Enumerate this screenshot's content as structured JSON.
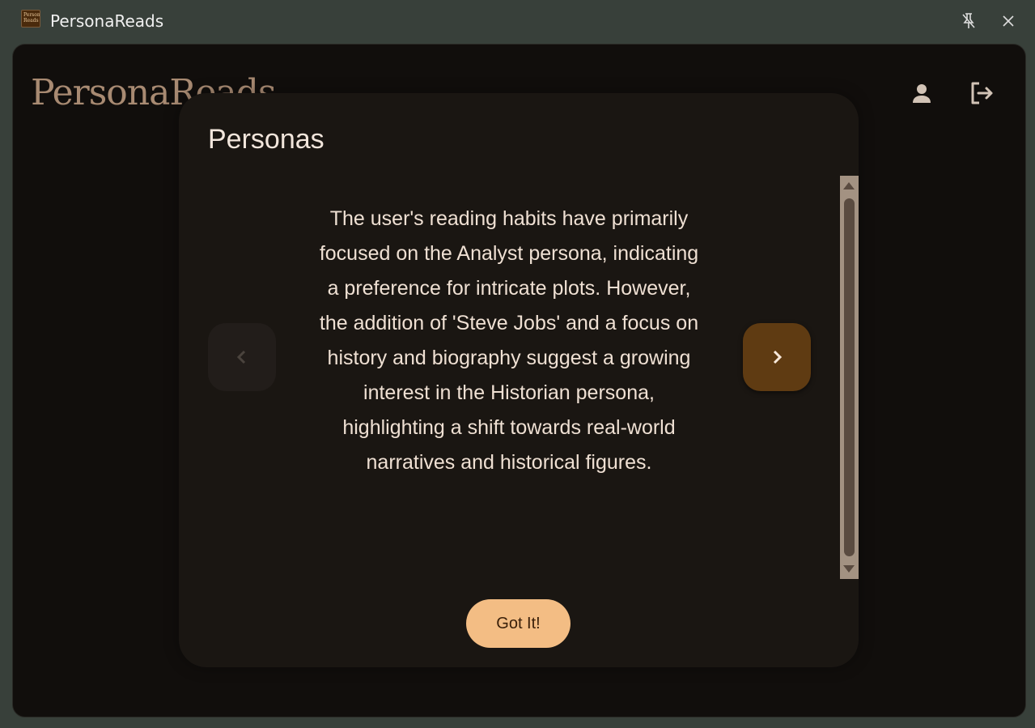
{
  "window": {
    "title": "PersonaReads",
    "icon_text": "Persona Reads",
    "icons": {
      "unpin": "unpin-icon",
      "close": "close-icon"
    }
  },
  "header": {
    "logo": "PersonaReads",
    "icons": {
      "profile": "person-icon",
      "logout": "logout-icon"
    }
  },
  "dialog": {
    "title": "Personas",
    "persona_description": "The user's reading habits have primarily focused on the Analyst persona, indicating a preference for intricate plots. However, the addition of 'Steve Jobs' and a focus on history and biography suggest a growing interest in the Historian persona, highlighting a shift towards real-world narratives and historical figures.",
    "prev_button_state": "disabled",
    "next_button_state": "enabled",
    "confirm_label": "Got It!"
  },
  "colors": {
    "titlebar": "#38403a",
    "background": "#110e0c",
    "dialog": "#1a1612",
    "accent_button": "#f3bd84",
    "next_button": "#5f3b12",
    "logo": "#a88a72"
  }
}
